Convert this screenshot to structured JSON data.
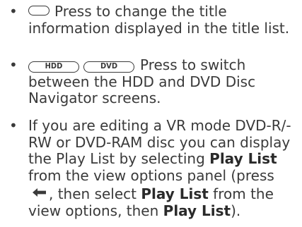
{
  "bullets": {
    "symbol": "•",
    "item1": {
      "button_icon": "blank-rounded-button-icon",
      "text": "Press to change the title information displayed in the title list."
    },
    "item2": {
      "button1_label": "HDD",
      "button2_label": "DVD",
      "text": "Press to switch between the HDD and DVD Disc Navigator screens."
    },
    "item3": {
      "text_a": "If you are editing a VR mode DVD-R/-RW or DVD-RAM disc you can display the Play List by selecting ",
      "bold_a": "Play List",
      "text_b": " from the view options panel (press ",
      "arrow_icon": "left-arrow-icon",
      "text_c": ", then select ",
      "bold_b": "Play List",
      "text_d": " from the view options, then ",
      "bold_c": "Play List",
      "text_e": ")."
    }
  }
}
